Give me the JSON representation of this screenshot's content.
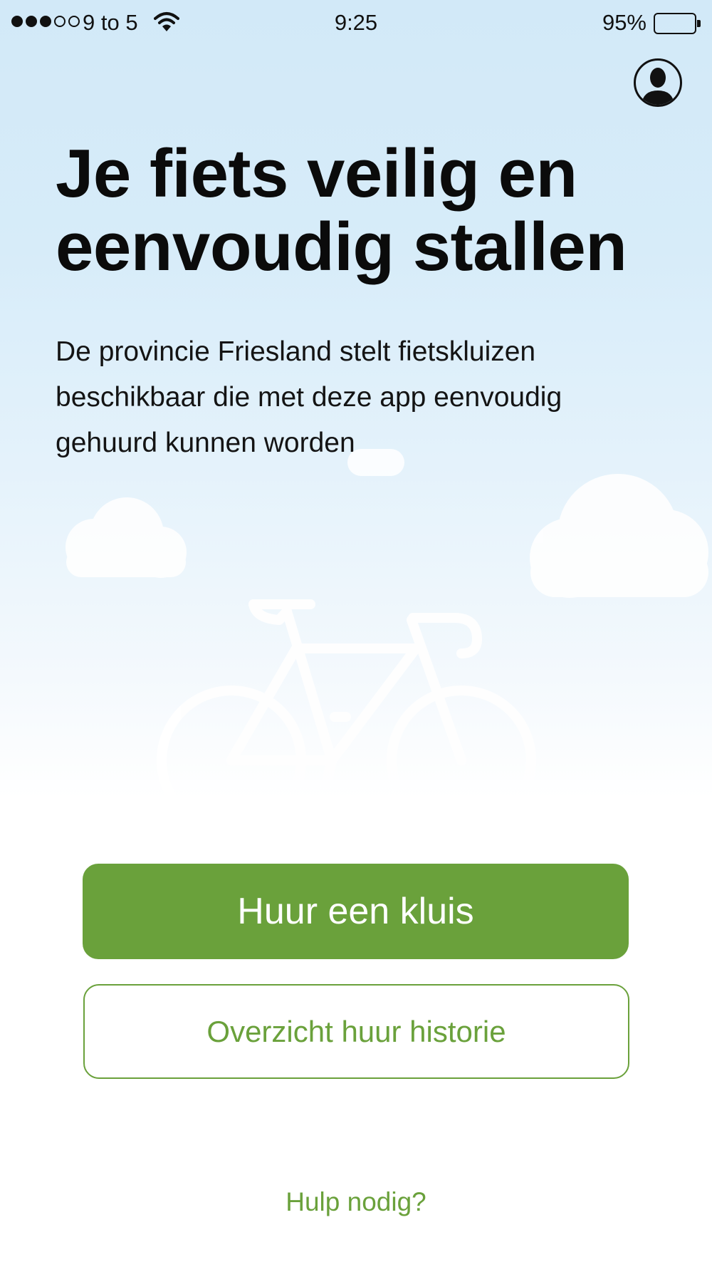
{
  "status_bar": {
    "signal_bars_filled": 3,
    "signal_bars_total": 5,
    "carrier": "9 to 5",
    "time": "9:25",
    "battery_percent": "95%"
  },
  "header": {
    "profile_icon": "user-avatar-icon"
  },
  "hero": {
    "title_line1": "Je fiets veilig en",
    "title_line2": "eenvoudig stallen",
    "intro_line1": "De provincie Friesland stelt fietskluizen",
    "intro_line2": "beschikbaar die met deze app eenvoudig",
    "intro_line3": "gehuurd kunnen worden"
  },
  "illustration": {
    "icons": [
      "cloud-icon",
      "cloud-icon",
      "cloud-icon",
      "bicycle-icon"
    ]
  },
  "actions": {
    "primary_label": "Huur een kluis",
    "secondary_label": "Overzicht huur historie",
    "help_label": "Hulp nodig?"
  },
  "colors": {
    "accent_green": "#6aa13b",
    "sky_top": "#d2e9f8",
    "text_dark": "#0b0b0b"
  }
}
